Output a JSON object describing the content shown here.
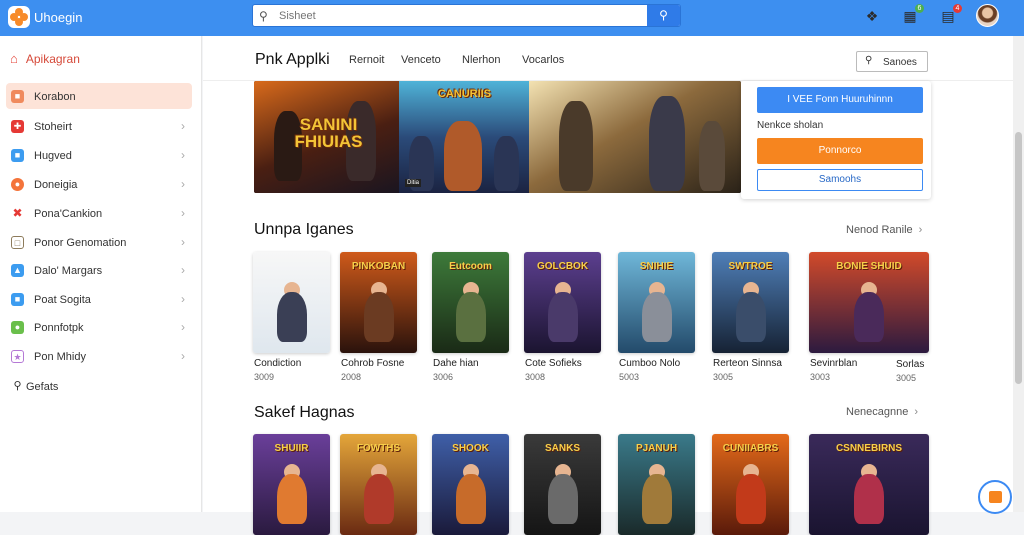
{
  "topbar": {
    "brand": "Uhoegin",
    "search_placeholder": "Sisheet",
    "search_icon": "search-icon",
    "icons": [
      {
        "name": "gamepad-icon",
        "badge": ""
      },
      {
        "name": "grid-icon",
        "badge": "6",
        "badge_color": "#4caf50"
      },
      {
        "name": "cart-icon",
        "badge": "4",
        "badge_color": "#e53935"
      }
    ]
  },
  "sidebar": {
    "header": "Apikagran",
    "items": [
      {
        "label": "Korabon",
        "icon": "home-tab-icon",
        "color": "#f08a5d",
        "active": true,
        "chevron": false
      },
      {
        "label": "Stoheirt",
        "icon": "puzzle-icon",
        "color": "#e53935",
        "chevron": true
      },
      {
        "label": "Hugved",
        "icon": "chat-icon",
        "color": "#3c9cf0",
        "chevron": true
      },
      {
        "label": "Doneigia",
        "icon": "game-icon",
        "color": "#f4743b",
        "chevron": true
      },
      {
        "label": "Pona'Cankion",
        "icon": "tools-icon",
        "color": "#e53935",
        "chevron": true
      },
      {
        "label": "Ponor Genomation",
        "icon": "box-icon",
        "color": "#8d7b5b",
        "chevron": true
      },
      {
        "label": "Dalo' Margars",
        "icon": "map-icon",
        "color": "#3c9cf0",
        "chevron": true
      },
      {
        "label": "Poat Sogita",
        "icon": "sport-icon",
        "color": "#3c9cf0",
        "chevron": true
      },
      {
        "label": "Ponnfotpk",
        "icon": "leaf-icon",
        "color": "#6abf4b",
        "chevron": true
      },
      {
        "label": "Pon Mhidy",
        "icon": "star-icon",
        "color": "#b579d6",
        "chevron": true
      },
      {
        "label": "Gefats",
        "icon": "search-icon",
        "color": "#333333",
        "chevron": false
      }
    ]
  },
  "nav": {
    "title": "Pnk Applki",
    "links": [
      "Rernoit",
      "Venceto",
      "Nlerhon",
      "Vocarlos"
    ],
    "search_label": "Sanoes"
  },
  "banner": {
    "title_a": "SANINI FHIUIAS",
    "title_b": "CANURIIS",
    "tag": "Ditia"
  },
  "promo": {
    "primary": "I VEE Fonn Huuruhinnn",
    "text": "Nenkce sholan",
    "orange": "Ponnorco",
    "outline": "Samoohs"
  },
  "section1": {
    "title": "Unnpa Iganes",
    "more": "Nenod Ranile",
    "items": [
      {
        "title": "",
        "name": "Condiction",
        "price": "3009",
        "color": "#f7f7f7",
        "bg2": "#dfe7ee",
        "hero": "#3a3f55"
      },
      {
        "title": "PINKOBAN",
        "name": "Cohrob Fosne",
        "price": "2008",
        "color": "#cf5a1a",
        "bg2": "#2a120c",
        "hero": "#6b3b22"
      },
      {
        "title": "Eutcoom",
        "name": "Dahe hian",
        "price": "3006",
        "color": "#3d7a3a",
        "bg2": "#1a2a16",
        "hero": "#5a7040"
      },
      {
        "title": "GOLCBOK",
        "name": "Cote Sofieks",
        "price": "3008",
        "color": "#5c3f8f",
        "bg2": "#1b1430",
        "hero": "#4a3a6a"
      },
      {
        "title": "SNIHIE",
        "name": "Cumboo Nolo",
        "price": "5003",
        "color": "#6fb7d9",
        "bg2": "#234a6a",
        "hero": "#8a8f99"
      },
      {
        "title": "SWTROE",
        "name": "Rerteon Sinnsa",
        "price": "3005",
        "color": "#4f7fb8",
        "bg2": "#162234",
        "hero": "#3a4d6a"
      },
      {
        "title": "BONIE SHUID",
        "name": "Sevinrblan",
        "price": "3003",
        "color": "#d24a2a",
        "bg2": "#2c1a3f",
        "hero": "#4a2a5a"
      }
    ],
    "tail": {
      "name": "Sorlas",
      "price": "3005"
    }
  },
  "section2": {
    "title": "Sakef Hagnas",
    "more": "Nenecagnne",
    "items": [
      {
        "title": "SHUIIR",
        "color": "#6a3f9a",
        "bg2": "#2a1a3f",
        "hero": "#e07a30"
      },
      {
        "title": "FOWTHS",
        "color": "#e4a63a",
        "bg2": "#6a2a12",
        "hero": "#b03a2a"
      },
      {
        "title": "SHOOK",
        "color": "#3f5fa8",
        "bg2": "#1a1a3a",
        "hero": "#c76b2a"
      },
      {
        "title": "SANKS",
        "color": "#3a3a3a",
        "bg2": "#151515",
        "hero": "#6a6a6a"
      },
      {
        "title": "PJANUH",
        "color": "#3a7a8a",
        "bg2": "#1a2a2a",
        "hero": "#a07a3a"
      },
      {
        "title": "CUNIIABRS",
        "color": "#e46a1a",
        "bg2": "#5a1a0a",
        "hero": "#c23a1a"
      },
      {
        "title": "CSNNEBIRNS",
        "color": "#3a2a5a",
        "bg2": "#1a1430",
        "hero": "#b0304a"
      }
    ]
  }
}
